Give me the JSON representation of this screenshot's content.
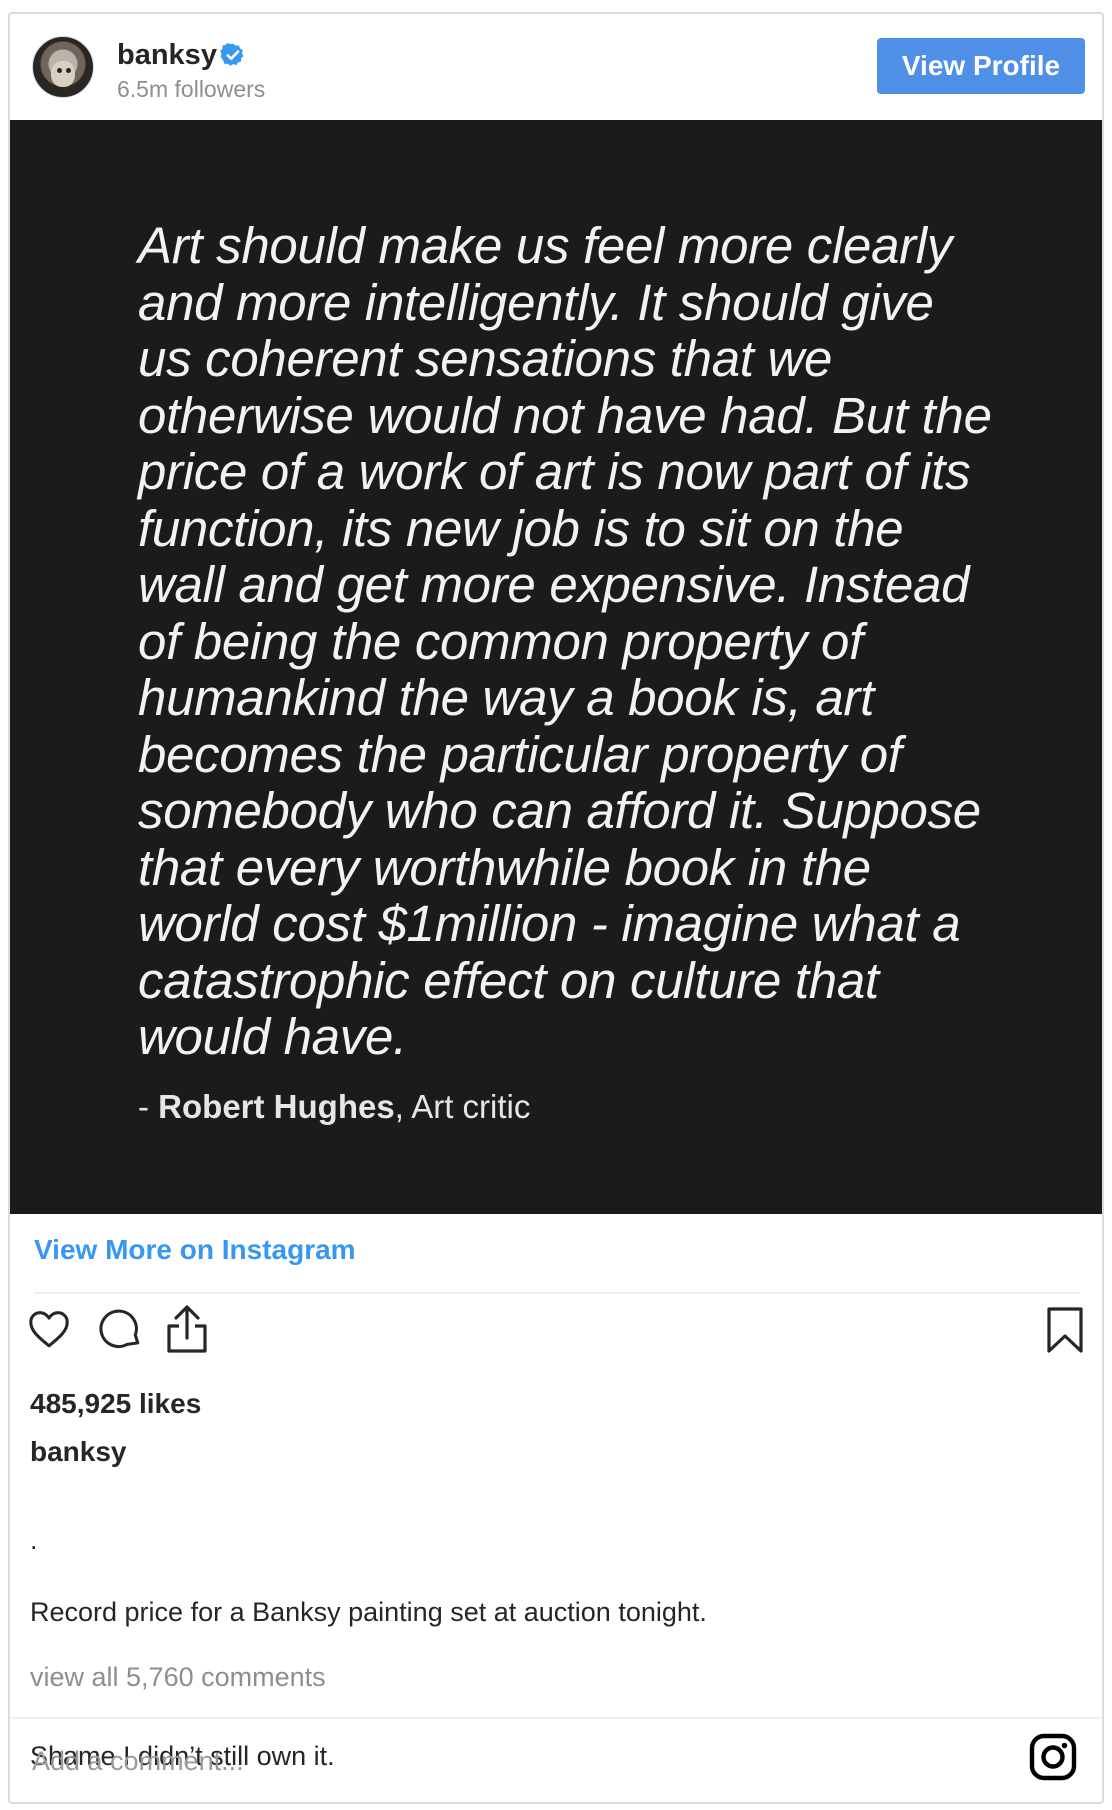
{
  "header": {
    "username": "banksy",
    "followers": "6.5m followers",
    "view_profile_label": "View Profile",
    "verified_icon": "verified-badge-icon"
  },
  "post_image": {
    "quote": "Art should make us feel more clearly and more intelligently. It should give us coherent sensations that we otherwise would not have had. But the price of a work of art is now part of its function, its new job is to sit on the wall and get more expensive. Instead of being the common property of humankind the way a book is, art becomes the particular property of somebody who can afford it. Suppose that every worthwhile book in the world cost $1million - imagine what a catastrophic effect on culture that would have.",
    "attribution_prefix": "- ",
    "attribution_name": "Robert Hughes",
    "attribution_role": ", Art critic"
  },
  "view_more_label": "View More on Instagram",
  "actions": {
    "like_icon": "heart-icon",
    "comment_icon": "comment-icon",
    "share_icon": "share-icon",
    "save_icon": "bookmark-icon"
  },
  "likes": "485,925 likes",
  "caption": {
    "user": "banksy",
    "text": ".\nRecord price for a Banksy painting set at auction tonight.\n\nShame I didn’t still own it."
  },
  "comments_link": "view all 5,760 comments",
  "add_comment": {
    "placeholder": "Add a comment...",
    "instagram_icon": "instagram-logo-icon"
  },
  "colors": {
    "accent": "#3897f0",
    "button": "#4f8fe6",
    "image_bg": "#1b1b1b",
    "text": "#262626",
    "muted": "#8e8e8e"
  }
}
